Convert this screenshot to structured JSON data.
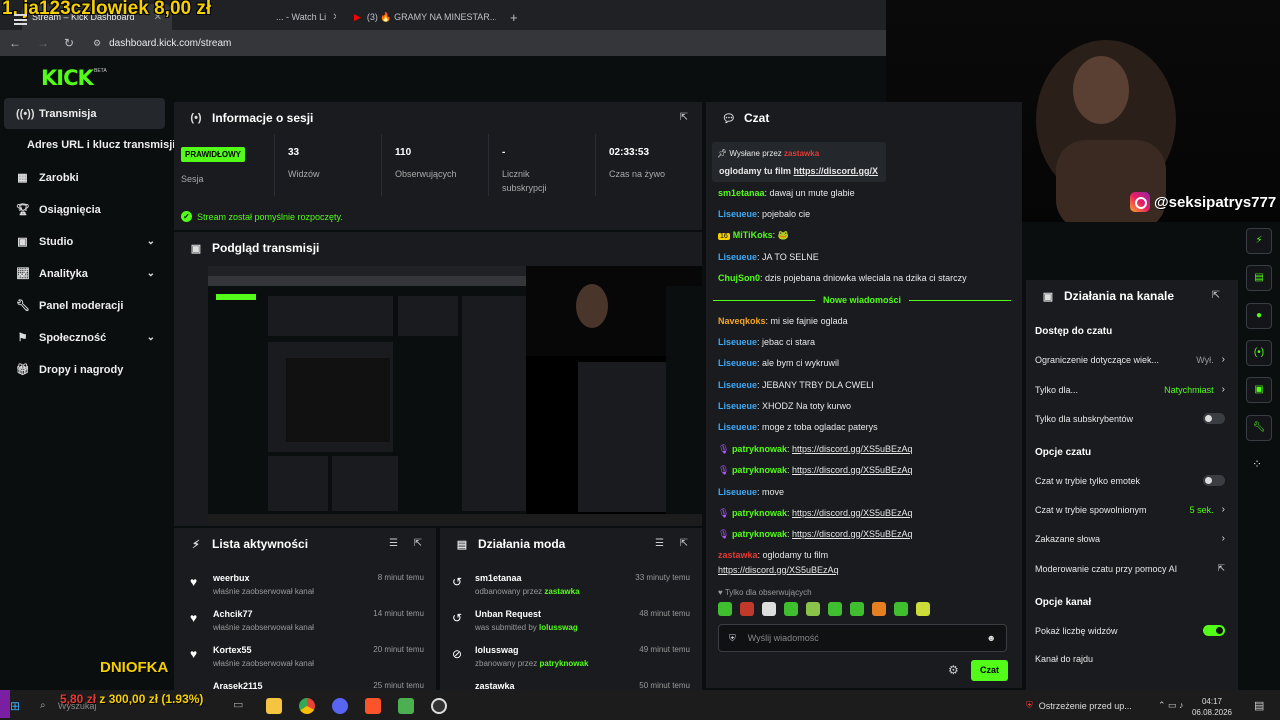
{
  "overlay": {
    "top_text": "1. ja123czlowiek 8,00 zł",
    "bottom_name": "DNIOFKA",
    "goal_text": "5,80 zł",
    "goal_rest": " z 300,00 zł (1.93%)",
    "goal_progress": 0.0193
  },
  "browser": {
    "tabs": [
      {
        "label": "Stream – Kick Dashboard",
        "active": true
      },
      {
        "label": "... - Watch Li",
        "active": false
      },
      {
        "label": "(3) 🔥 GRAMY NA MINESTAR...",
        "active": false
      }
    ],
    "url": "dashboard.kick.com/stream"
  },
  "brand": {
    "logo": "KICK",
    "beta": "BETA",
    "accent": "#53fc18"
  },
  "sidebar": {
    "items": [
      {
        "label": "Transmisja",
        "icon": "broadcast-icon",
        "active": true
      },
      {
        "label": "Adres URL i klucz transmisji",
        "sub": true
      },
      {
        "label": "Zarobki",
        "icon": "chart-icon"
      },
      {
        "label": "Osiągnięcia",
        "icon": "trophy-icon"
      },
      {
        "label": "Studio",
        "icon": "studio-icon",
        "expand": true
      },
      {
        "label": "Analityka",
        "icon": "analytics-icon",
        "expand": true
      },
      {
        "label": "Panel moderacji",
        "icon": "wrench-icon"
      },
      {
        "label": "Społeczność",
        "icon": "community-icon",
        "expand": true
      },
      {
        "label": "Dropy i nagrody",
        "icon": "gift-icon"
      }
    ]
  },
  "session": {
    "title": "Informacje o sesji",
    "status_badge": "PRAWIDŁOWY",
    "status_label": "Sesja",
    "stats": [
      {
        "value": "33",
        "label": "Widzów"
      },
      {
        "value": "110",
        "label": "Obserwujących"
      },
      {
        "value": "-",
        "label": "Licznik subskrypcji"
      },
      {
        "value": "02:33:53",
        "label": "Czas na żywo"
      }
    ],
    "success_msg": "Stream został pomyślnie rozpoczęty."
  },
  "preview": {
    "title": "Podgląd transmisji"
  },
  "activity": {
    "title": "Lista aktywności",
    "items": [
      {
        "name": "weerbux",
        "sub": "właśnie zaobserwował kanał",
        "time": "8 minut temu"
      },
      {
        "name": "Achcik77",
        "sub": "właśnie zaobserwował kanał",
        "time": "14 minut temu"
      },
      {
        "name": "Kortex55",
        "sub": "właśnie zaobserwował kanał",
        "time": "20 minut temu"
      },
      {
        "name": "Arasek2115",
        "sub": "",
        "time": "25 minut temu"
      }
    ]
  },
  "mod": {
    "title": "Działania moda",
    "items": [
      {
        "name": "sm1etanaa",
        "sub": "odbanowany przez ",
        "by": "zastawka",
        "time": "33 minuty temu"
      },
      {
        "name": "Unban Request",
        "sub": "was submitted by ",
        "by": "lolusswag",
        "time": "48 minut temu"
      },
      {
        "name": "lolusswag",
        "sub": "zbanowany przez ",
        "by": "patryknowak",
        "time": "49 minut temu"
      },
      {
        "name": "zastawka",
        "sub": "",
        "by": "",
        "time": "50 minut temu"
      }
    ]
  },
  "chat": {
    "title": "Czat",
    "pinned_label": "Wysłane przez",
    "pinned_user": "zastawka",
    "pinned_text": "oglodamy tu film ",
    "pinned_link": "https://discord.gg/X",
    "new_messages": "Nowe wiadomości",
    "messages": [
      {
        "user": "sm1etanaa",
        "color": "#53fc18",
        "text": "dawaj un mute glabie"
      },
      {
        "user": "Liseueue",
        "color": "#3fa9f5",
        "text": "pojebalo cie"
      },
      {
        "user": "MiTiKoks",
        "color": "#53fc18",
        "text": "🐸",
        "badge": "16"
      },
      {
        "user": "Liseueue",
        "color": "#3fa9f5",
        "text": "JA TO SELNE"
      },
      {
        "user": "ChujSon0",
        "color": "#53fc18",
        "text": "dzis pojebana dniowka wleciala na dzika ci starczy"
      },
      {
        "user": "Naveqkoks",
        "color": "#f5a623",
        "text": "mi sie fajnie oglada"
      },
      {
        "user": "Liseueue",
        "color": "#3fa9f5",
        "text": "jebac ci stara"
      },
      {
        "user": "Liseueue",
        "color": "#3fa9f5",
        "text": "ale bym ci wykruwil"
      },
      {
        "user": "Liseueue",
        "color": "#3fa9f5",
        "text": "JEBANY TRBY DLA CWELI"
      },
      {
        "user": "Liseueue",
        "color": "#3fa9f5",
        "text": "XHODZ Na toty kurwo"
      },
      {
        "user": "Liseueue",
        "color": "#3fa9f5",
        "text": "moge z toba ogladac paterys"
      },
      {
        "user": "patryknowak",
        "color": "#53fc18",
        "link": "https://discord.gg/XS5uBEzAq"
      },
      {
        "user": "patryknowak",
        "color": "#53fc18",
        "link": "https://discord.gg/XS5uBEzAq"
      },
      {
        "user": "Liseueue",
        "color": "#3fa9f5",
        "text": "move"
      },
      {
        "user": "patryknowak",
        "color": "#53fc18",
        "link": "https://discord.gg/XS5uBEzAq"
      },
      {
        "user": "patryknowak",
        "color": "#53fc18",
        "link": "https://discord.gg/XS5uBEzAq"
      },
      {
        "user": "zastawka",
        "color": "#e53935",
        "text": "oglodamy tu film"
      }
    ],
    "last_link": "https://discord.gg/XS5uBEzAq",
    "followers_only": "Tylko dla obserwujących",
    "input_placeholder": "Wyślij wiadomość",
    "send": "Czat"
  },
  "channel": {
    "title": "Działania na kanale",
    "sec_access": "Dostęp do czatu",
    "age_label": "Ograniczenie dotyczące wiek...",
    "age_val": "Wył.",
    "only_label": "Tylko dla...",
    "only_val": "Natychmiast",
    "subs_label": "Tylko dla subskrybentów",
    "sec_chat": "Opcje czatu",
    "emote_label": "Czat w trybie tylko emotek",
    "slow_label": "Czat w trybie spowolnionym",
    "slow_val": "5 sek.",
    "banned_words": "Zakazane słowa",
    "ai_mod": "Moderowanie czatu przy pomocy AI",
    "sec_channel": "Opcje kanał",
    "viewers_label": "Pokaż liczbę widzów",
    "raid_label": "Kanał do rajdu"
  },
  "overlay_cam": {
    "instagram": "@seksipatrys777"
  },
  "taskbar": {
    "search": "Wyszukaj",
    "warning": "Ostrzeżenie przed up...",
    "time": "04:17",
    "date": "06.08.2026"
  }
}
